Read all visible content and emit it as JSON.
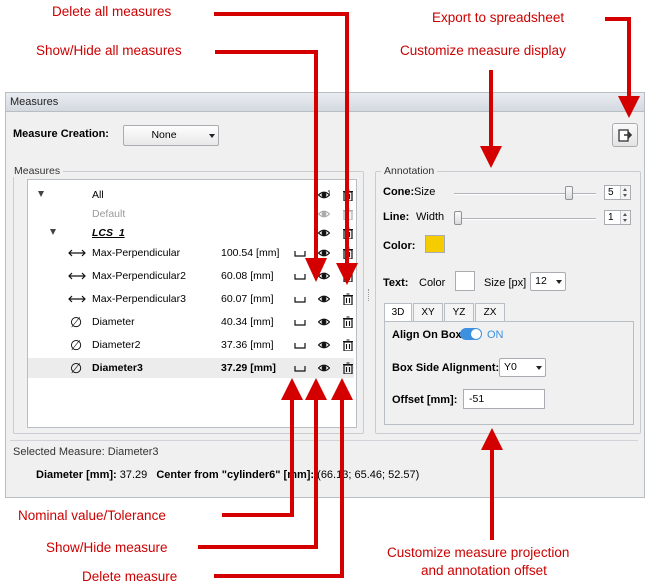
{
  "annotations": {
    "delete_all": "Delete all measures",
    "show_hide_all": "Show/Hide all measures",
    "export": "Export to spreadsheet",
    "customize_display": "Customize measure display",
    "nominal": "Nominal value/Tolerance",
    "show_hide": "Show/Hide measure",
    "delete_measure": "Delete measure",
    "projection_line1": "Customize measure projection",
    "projection_line2": "and annotation offset"
  },
  "window": {
    "title": "Measures"
  },
  "creation": {
    "label": "Measure Creation:",
    "value": "None"
  },
  "measures": {
    "group_title": "Measures",
    "all_label": "All",
    "default_label": "Default",
    "lcs_label": "LCS_1",
    "items": [
      {
        "icon": "perpendicular-icon",
        "name": "Max-Perpendicular",
        "value": "100.54 [mm]"
      },
      {
        "icon": "perpendicular-icon",
        "name": "Max-Perpendicular2",
        "value": "60.08 [mm]"
      },
      {
        "icon": "perpendicular-icon",
        "name": "Max-Perpendicular3",
        "value": "60.07 [mm]"
      },
      {
        "icon": "diameter-icon",
        "name": "Diameter",
        "value": "40.34 [mm]"
      },
      {
        "icon": "diameter-icon",
        "name": "Diameter2",
        "value": "37.36 [mm]"
      },
      {
        "icon": "diameter-icon",
        "name": "Diameter3",
        "value": "37.29 [mm]",
        "selected": true
      }
    ]
  },
  "annotation_panel": {
    "title": "Annotation",
    "cone_label": "Cone:",
    "cone_size_label": "Size",
    "cone_value": "5",
    "cone_fraction": 0.83,
    "line_label": "Line:",
    "line_width_label": "Width",
    "line_value": "1",
    "line_fraction": 0.0,
    "color_label": "Color:",
    "color_value": "#f5cc00",
    "text_label": "Text:",
    "text_color_label": "Color",
    "text_color_value": "#ffffff",
    "size_label": "Size [px]",
    "size_value": "12",
    "tabs": [
      "3D",
      "XY",
      "YZ",
      "ZX"
    ],
    "active_tab": "3D",
    "align_label": "Align On Box:",
    "align_state": "ON",
    "box_side_label": "Box Side Alignment:",
    "box_side_value": "Y0",
    "offset_label": "Offset [mm]:",
    "offset_value": "-51"
  },
  "status": {
    "selected": "Selected Measure: Diameter3",
    "diameter_label": "Diameter [mm]:",
    "diameter_value": "37.29",
    "center_label": "Center from \"cylinder6\" [mm]:",
    "center_value": "(66.13; 65.46; 52.57)"
  },
  "colors": {
    "annotation": "#cc0000",
    "toggle": "#3d8fe0",
    "toggle_text": "#3d8fe0"
  }
}
